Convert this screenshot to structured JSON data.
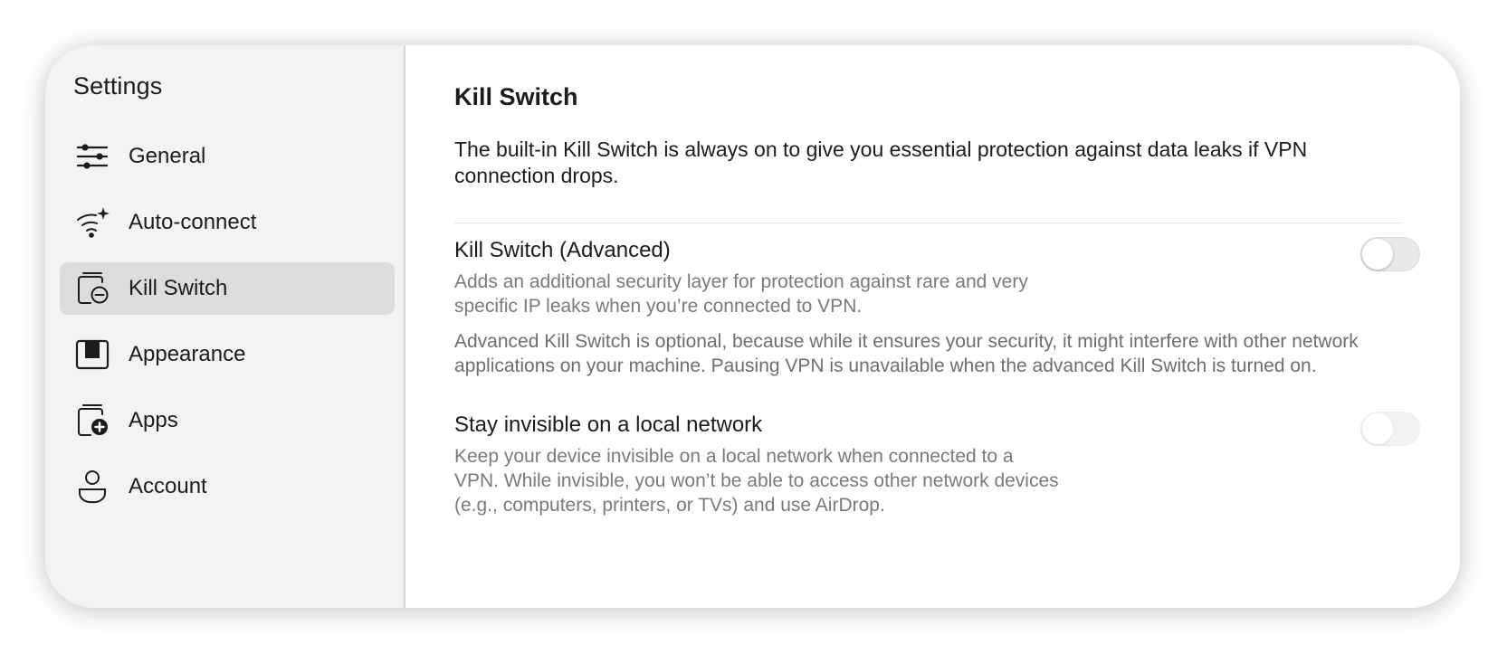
{
  "sidebar": {
    "title": "Settings",
    "items": [
      {
        "label": "General",
        "icon": "sliders-icon",
        "active": false
      },
      {
        "label": "Auto-connect",
        "icon": "wifi-sparkle-icon",
        "active": false
      },
      {
        "label": "Kill Switch",
        "icon": "kill-switch-icon",
        "active": true
      },
      {
        "label": "Appearance",
        "icon": "appearance-icon",
        "active": false
      },
      {
        "label": "Apps",
        "icon": "apps-add-icon",
        "active": false
      },
      {
        "label": "Account",
        "icon": "account-icon",
        "active": false
      }
    ]
  },
  "main": {
    "title": "Kill Switch",
    "intro": "The built-in Kill Switch is always on to give you essential protection against data leaks if VPN connection drops.",
    "settings": [
      {
        "title": "Kill Switch (Advanced)",
        "description": "Adds an additional security layer for protection against rare and very specific IP leaks when you’re connected to VPN.",
        "note": "Advanced Kill Switch is optional, because while it ensures your security, it might interfere with other network applications on your machine. Pausing VPN is unavailable when the advanced Kill Switch is turned on.",
        "enabled": false,
        "disabled_control": false
      },
      {
        "title": "Stay invisible on a local network",
        "description": "Keep your device invisible on a local network when connected to a VPN. While invisible, you won’t be able to access other network devices (e.g., computers, printers, or TVs) and use AirDrop.",
        "enabled": false,
        "disabled_control": true
      }
    ]
  },
  "colors": {
    "sidebar_bg": "#f3f3f3",
    "active_item_bg": "#dcdcdc",
    "text_primary": "#1c1c1e",
    "text_secondary": "#7a7a7a"
  }
}
